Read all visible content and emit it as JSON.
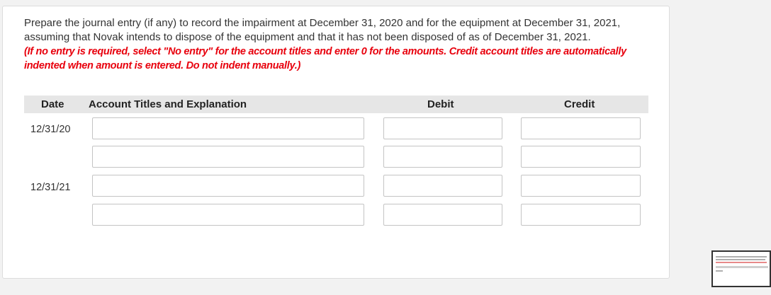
{
  "instructions": {
    "text": "Prepare the journal entry (if any) to record the impairment at December 31, 2020 and for the equipment at December 31, 2021, assuming that Novak intends to dispose of the equipment and that it has not been disposed of as of December 31, 2021.",
    "note": "(If no entry is required, select \"No entry\" for the account titles and enter 0 for the amounts. Credit account titles are automatically indented when amount is entered. Do not indent manually.)"
  },
  "table": {
    "headers": {
      "date": "Date",
      "account": "Account Titles and Explanation",
      "debit": "Debit",
      "credit": "Credit"
    },
    "rows": [
      {
        "date": "12/31/20",
        "account": "",
        "debit": "",
        "credit": ""
      },
      {
        "date": "",
        "account": "",
        "debit": "",
        "credit": ""
      },
      {
        "date": "12/31/21",
        "account": "",
        "debit": "",
        "credit": ""
      },
      {
        "date": "",
        "account": "",
        "debit": "",
        "credit": ""
      }
    ]
  }
}
